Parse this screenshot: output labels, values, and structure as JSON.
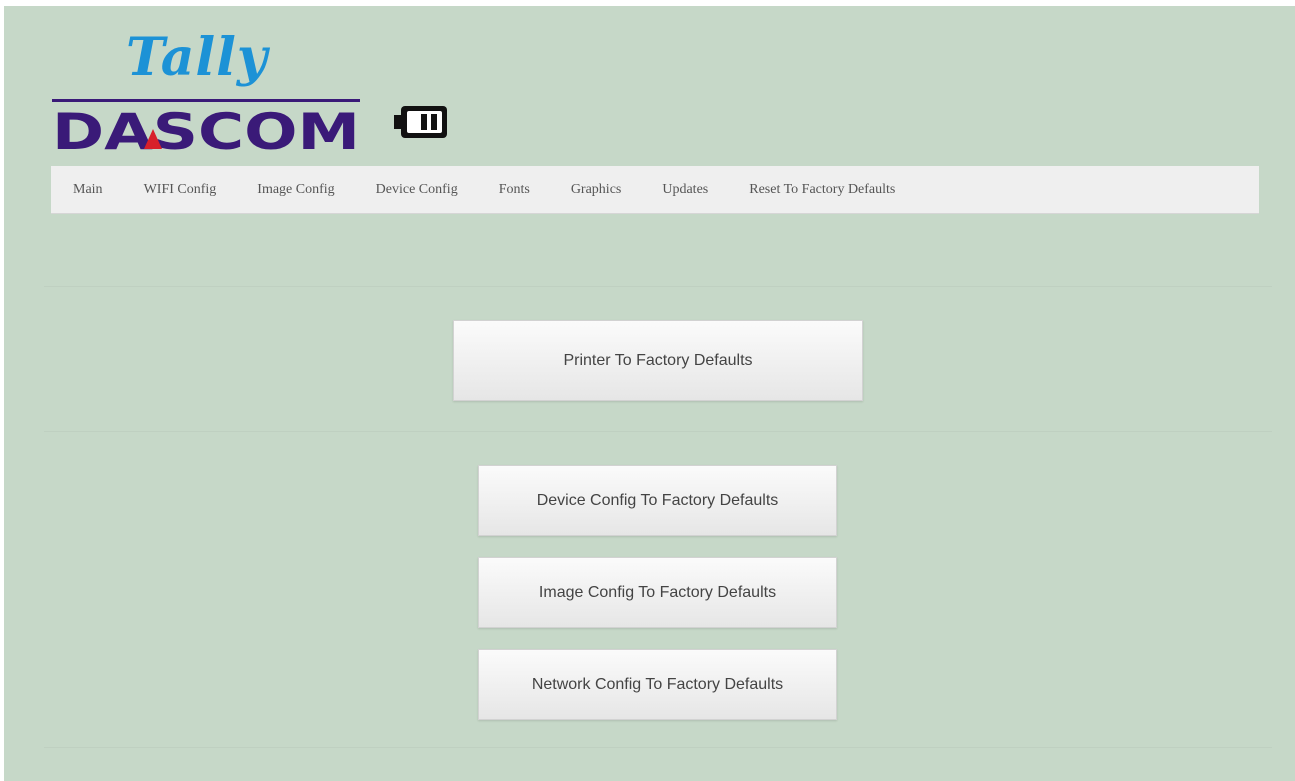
{
  "logo": {
    "tally_text": "Tally",
    "dascom_text": "DASCOM",
    "mark_icon": "printer-battery-icon",
    "colors": {
      "tally": "#1c92d6",
      "dascom": "#3a1a78",
      "accent": "#d8202a"
    }
  },
  "nav": {
    "items": [
      {
        "label": "Main"
      },
      {
        "label": "WIFI Config"
      },
      {
        "label": "Image Config"
      },
      {
        "label": "Device Config"
      },
      {
        "label": "Fonts"
      },
      {
        "label": "Graphics"
      },
      {
        "label": "Updates"
      },
      {
        "label": "Reset To Factory Defaults"
      }
    ]
  },
  "actions": {
    "printer_defaults": "Printer To Factory Defaults",
    "device_defaults": "Device Config To Factory Defaults",
    "image_defaults": "Image Config To Factory Defaults",
    "network_defaults": "Network Config To Factory Defaults"
  },
  "colors": {
    "background": "#c6d8c8",
    "navbar": "#efefef"
  }
}
